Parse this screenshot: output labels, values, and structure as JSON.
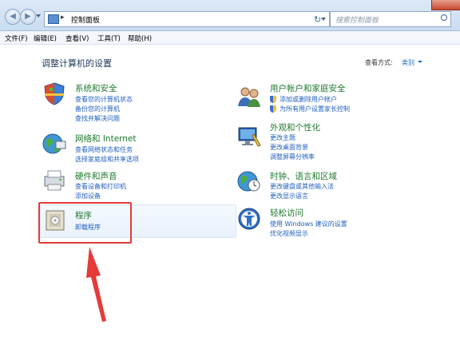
{
  "window": {
    "address_crumb": "控制面板",
    "address_separator": "▸",
    "search_placeholder": "搜索控制面板",
    "back_glyph": "◀",
    "forward_glyph": "▶",
    "refresh_glyph": "↻"
  },
  "menubar": [
    {
      "label": "文件(F)"
    },
    {
      "label": "编辑(E)"
    },
    {
      "label": "查看(V)"
    },
    {
      "label": "工具(T)"
    },
    {
      "label": "帮助(H)"
    }
  ],
  "content": {
    "heading": "调整计算机的设置",
    "view_by_label": "查看方式:",
    "view_by_value": "类别"
  },
  "categories": [
    {
      "title": "系统和安全",
      "links": [
        "查看您的计算机状态",
        "备份您的计算机",
        "查找并解决问题"
      ]
    },
    {
      "title": "网络和 Internet",
      "links": [
        "查看网络状态和任务",
        "选择家庭组和共享选项"
      ]
    },
    {
      "title": "硬件和声音",
      "links": [
        "查看设备和打印机",
        "添加设备"
      ]
    },
    {
      "title": "程序",
      "links": [
        "卸载程序"
      ]
    },
    {
      "title": "用户帐户和家庭安全",
      "links": [
        "添加或删除用户帐户",
        "为所有用户设置家长控制"
      ]
    },
    {
      "title": "外观和个性化",
      "links": [
        "更改主题",
        "更改桌面背景",
        "调整屏幕分辨率"
      ]
    },
    {
      "title": "时钟、语言和区域",
      "links": [
        "更改键盘或其他输入法",
        "更改显示语言"
      ]
    },
    {
      "title": "轻松访问",
      "links": [
        "使用 Windows 建议的设置",
        "优化视频显示"
      ]
    }
  ],
  "colors": {
    "category_title": "#1f7a2d",
    "link": "#1f5fbf",
    "annotation_red": "#e53a3a"
  }
}
